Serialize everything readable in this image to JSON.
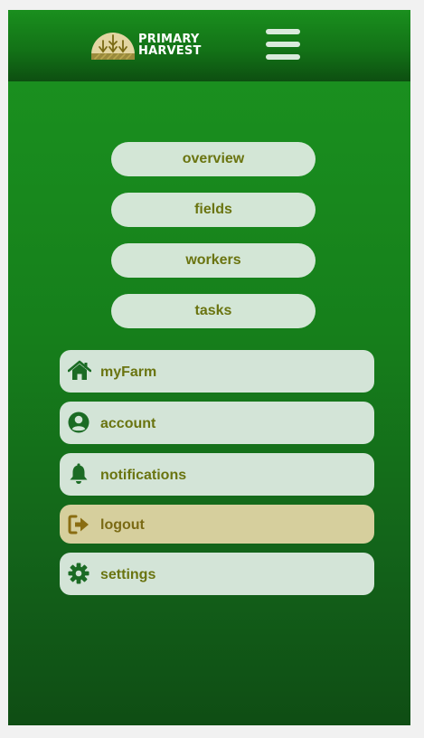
{
  "brand": {
    "line1": "PRIMARY",
    "line2": "HARVEST"
  },
  "icons": {
    "logo": "wheat-sun-logo-icon",
    "menu": "hamburger-menu-icon",
    "myfarm": "home-icon",
    "account": "user-circle-icon",
    "notifications": "bell-icon",
    "logout": "logout-arrow-icon",
    "settings": "gear-icon"
  },
  "nav": {
    "overview": "overview",
    "fields": "fields",
    "workers": "workers",
    "tasks": "tasks"
  },
  "menu": {
    "myfarm": "myFarm",
    "account": "account",
    "notifications": "notifications",
    "logout": "logout",
    "settings": "settings"
  },
  "colors": {
    "background_top": "#1b9420",
    "background_bottom": "#0f4d14",
    "pill": "#d3e6d6",
    "label_text": "#6a7410",
    "icon": "#1b6b24",
    "logout_bg": "#d6cf9d",
    "logout_icon": "#8a6d12"
  }
}
